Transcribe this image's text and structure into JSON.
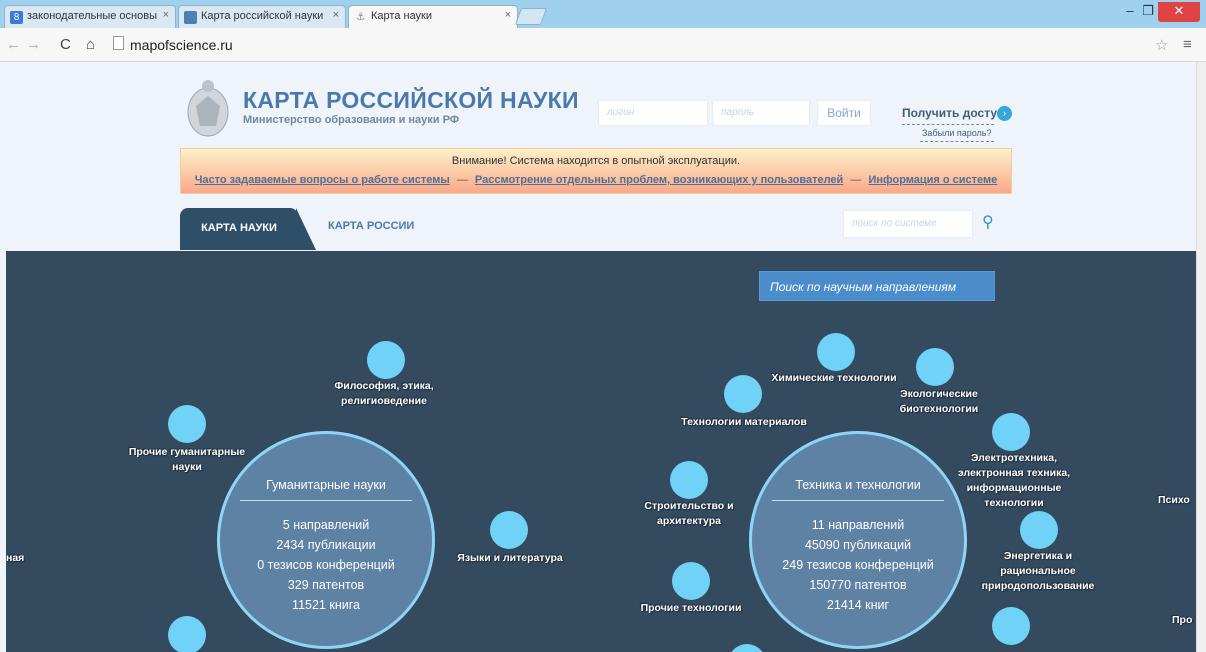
{
  "browser": {
    "tabs": [
      {
        "title": "законодательные основы",
        "icon": "8"
      },
      {
        "title": "Карта российской науки",
        "icon": ""
      },
      {
        "title": "Карта науки",
        "icon": ""
      }
    ],
    "url": "mapofscience.ru",
    "close_symbol": "×"
  },
  "header": {
    "title": "КАРТА РОССИЙСКОЙ НАУКИ",
    "subtitle": "Министерство образования и науки РФ",
    "login_placeholder": "логин",
    "password_placeholder": "пароль",
    "login_button": "Войти",
    "get_access": "Получить доступ",
    "forgot_password": "Забыли пароль?"
  },
  "notice": {
    "line1": "Внимание! Система находится в опытной эксплуатации.",
    "link_faq": "Часто задаваемые вопросы о работе системы",
    "link_problems": "Рассмотрение отдельных проблем, возникающих у пользователей",
    "link_info": "Информация о системе",
    "separator": "—"
  },
  "nav_tabs": {
    "map_science": "КАРТА НАУКИ",
    "map_russia": "КАРТА РОССИИ",
    "search_placeholder": "поиск по системе"
  },
  "map": {
    "search_label": "Поиск по научным направлениям",
    "humanities": {
      "title": "Гуманитарные науки",
      "directions": "5 направлений",
      "publications": "2434 публикации",
      "theses": "0 тезисов конференций",
      "patents": "329 патентов",
      "books": "11521 книга"
    },
    "technology": {
      "title": "Техника и технологии",
      "directions": "11 направлений",
      "publications": "45090 публикаций",
      "theses": "249 тезисов конференций",
      "patents": "150770 патентов",
      "books": "21414 книг"
    },
    "labels": {
      "philosophy": "Философия, этика,\nрелигиоведение",
      "other_humanities": "Прочие гуманитарные\nнауки",
      "languages": "Языки и литература",
      "left_cut": "ная",
      "chemical": "Химические технологии",
      "ecological": "Экологические\nбиотехнологии",
      "materials": "Технологии материалов",
      "electrical": "Электротехника,\nэлектронная техника,\nинформационные\nтехнологии",
      "construction": "Строительство и\nархитектура",
      "energy": "Энергетика и\nрациональное\nприродопользование",
      "other_tech": "Прочие технологии",
      "right_cut_1": "Психо",
      "right_cut_2": "Про"
    }
  },
  "colors": {
    "map_bg": "#344a5f",
    "node": "#6fd2f6",
    "brand": "#4b79ad",
    "search_bar": "#4b8ccb"
  }
}
